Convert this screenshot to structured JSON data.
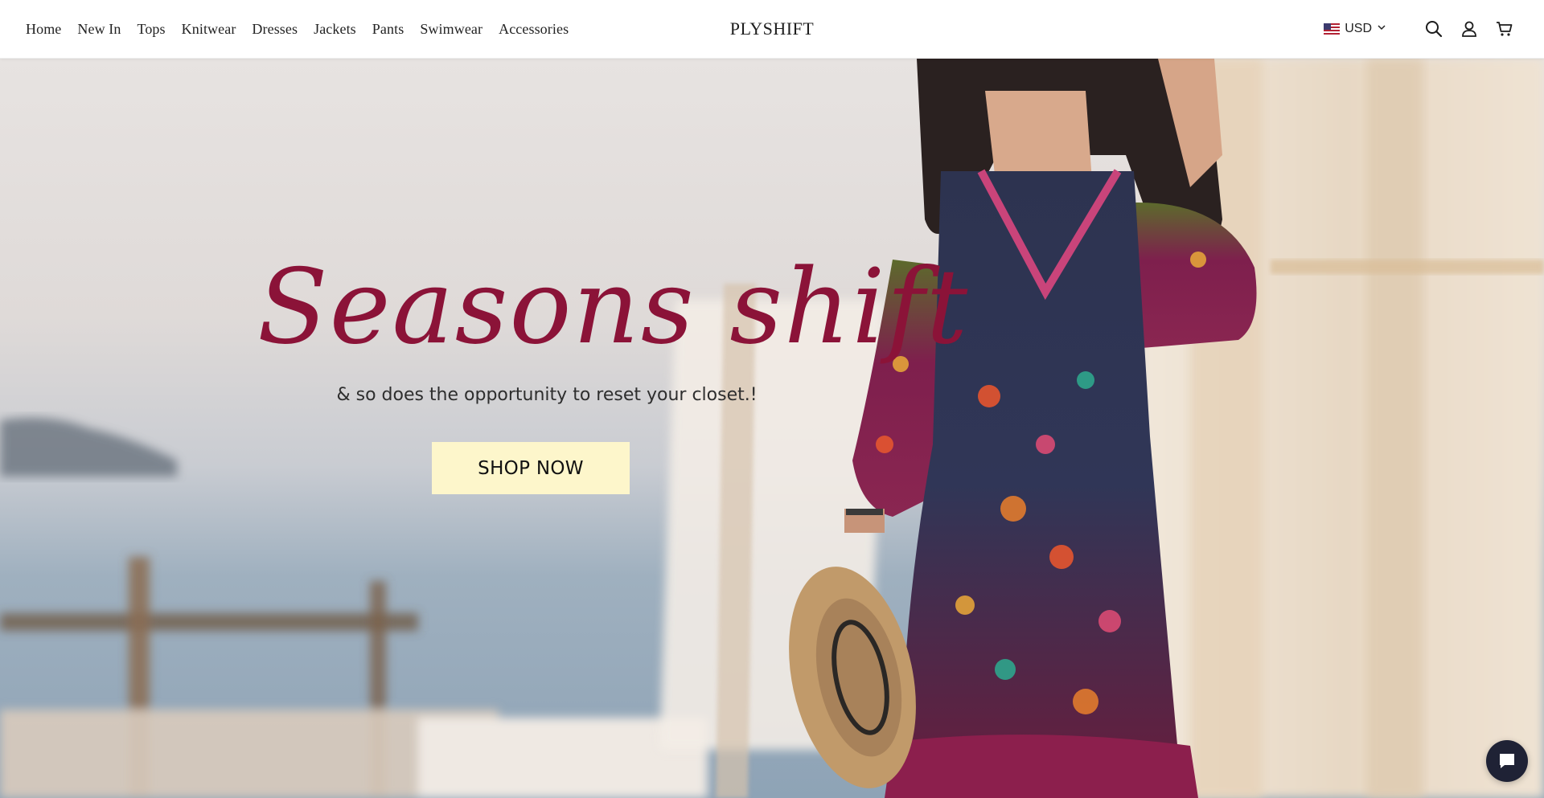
{
  "nav": {
    "items": [
      {
        "label": "Home"
      },
      {
        "label": "New In"
      },
      {
        "label": "Tops"
      },
      {
        "label": "Knitwear"
      },
      {
        "label": "Dresses"
      },
      {
        "label": "Jackets"
      },
      {
        "label": "Pants"
      },
      {
        "label": "Swimwear"
      },
      {
        "label": "Accessories"
      }
    ]
  },
  "brand": {
    "name": "PLYSHIFT"
  },
  "header_actions": {
    "currency": "USD",
    "currency_flag_icon": "us-flag-icon",
    "icons": [
      "chevron-down-icon",
      "search-icon",
      "account-icon",
      "cart-icon"
    ]
  },
  "hero": {
    "headline": "Seasons shift",
    "subline": "& so does the opportunity to reset your closet.!",
    "cta_label": "SHOP NOW",
    "colors": {
      "headline": "#8b1338",
      "cta_background": "#fdf6cb",
      "cta_text": "#111111"
    }
  },
  "chat": {
    "icon": "chat-bubble-icon",
    "background": "#1f2235"
  }
}
